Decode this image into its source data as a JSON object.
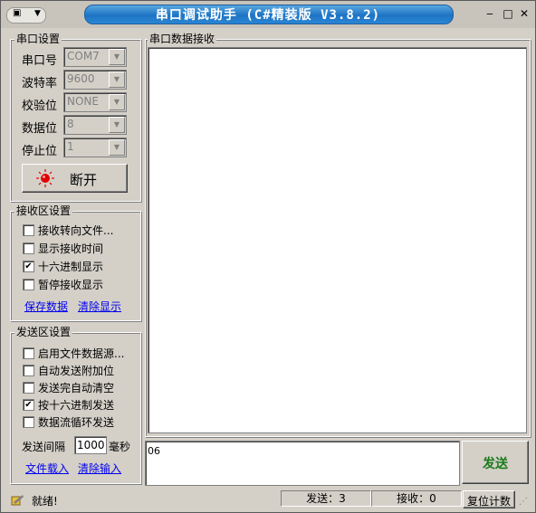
{
  "window": {
    "title": "串口调试助手 (C#精装版 V3.8.2)",
    "sysmenu_icon": "menu-icon",
    "min_glyph": "‒",
    "max_glyph": "□",
    "close_glyph": "✕"
  },
  "serial": {
    "group_title": "串口设置",
    "port_label": "串口号",
    "port_value": "COM7",
    "baud_label": "波特率",
    "baud_value": "9600",
    "parity_label": "校验位",
    "parity_value": "NONE",
    "databits_label": "数据位",
    "databits_value": "8",
    "stopbits_label": "停止位",
    "stopbits_value": "1",
    "connect_label": "断开",
    "connect_color": "#e00000"
  },
  "receive": {
    "group_title": "接收区设置",
    "options": [
      {
        "label": "接收转向文件...",
        "checked": false
      },
      {
        "label": "显示接收时间",
        "checked": false
      },
      {
        "label": "十六进制显示",
        "checked": true
      },
      {
        "label": "暂停接收显示",
        "checked": false
      }
    ],
    "save_link": "保存数据",
    "clear_link": "清除显示",
    "panel_title": "串口数据接收"
  },
  "send": {
    "group_title": "发送区设置",
    "options": [
      {
        "label": "启用文件数据源...",
        "checked": false
      },
      {
        "label": "自动发送附加位",
        "checked": false
      },
      {
        "label": "发送完自动清空",
        "checked": false
      },
      {
        "label": "按十六进制发送",
        "checked": true
      },
      {
        "label": "数据流循环发送",
        "checked": false
      }
    ],
    "interval_label": "发送间隔",
    "interval_value": "1000",
    "interval_unit": "毫秒",
    "load_link": "文件载入",
    "clear_link": "清除输入",
    "input_value": "06",
    "send_button": "发送",
    "send_color": "#1a7a1a"
  },
  "status": {
    "text": "就绪!",
    "sent": "发送：3",
    "received": "接收：0",
    "reset_button": "复位计数"
  }
}
